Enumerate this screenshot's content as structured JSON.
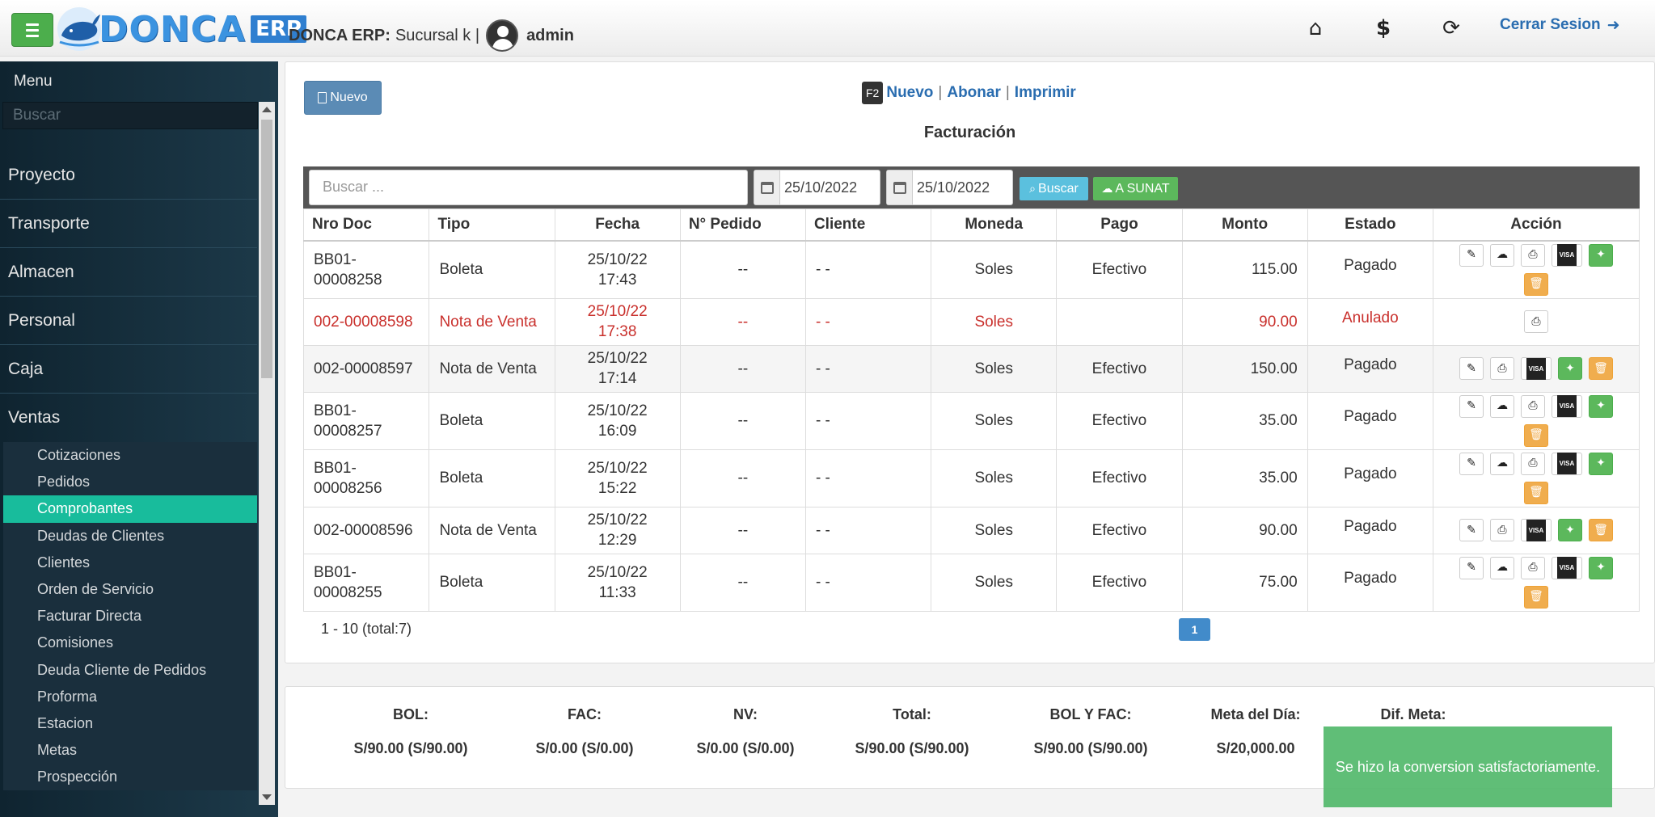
{
  "header": {
    "logo_name": "DONCA",
    "logo_suffix": "ERP",
    "brand_label": "DONCA ERP:",
    "branch": "Sucursal k |",
    "user": "admin",
    "icons": [
      "home-icon",
      "dollar-icon",
      "lock-refresh-icon"
    ],
    "logout_label": "Cerrar Sesion"
  },
  "sidebar": {
    "title": "Menu",
    "search_placeholder": "Buscar",
    "main_items": [
      "Proyecto",
      "Transporte",
      "Almacen",
      "Personal",
      "Caja",
      "Ventas"
    ],
    "sub_items": [
      "Cotizaciones",
      "Pedidos",
      "Comprobantes",
      "Deudas de Clientes",
      "Clientes",
      "Orden de Servicio",
      "Facturar Directa",
      "Comisiones",
      "Deuda Cliente de Pedidos",
      "Proforma",
      "Estacion",
      "Metas",
      "Prospección"
    ],
    "active_sub": "Comprobantes"
  },
  "toolbar": {
    "nuevo_label": "Nuevo",
    "shortcut_key": "F2",
    "link_nuevo": "Nuevo",
    "link_abonar": "Abonar",
    "link_imprimir": "Imprimir",
    "title": "Facturación"
  },
  "filters": {
    "search_placeholder": "Buscar ...",
    "date_from": "25/10/2022",
    "date_to": "25/10/2022",
    "buscar_label": "Buscar",
    "sunat_label": "A SUNAT"
  },
  "table": {
    "columns": [
      "Nro Doc",
      "Tipo",
      "Fecha",
      "N° Pedido",
      "Cliente",
      "Moneda",
      "Pago",
      "Monto",
      "Estado",
      "Acción"
    ],
    "rows": [
      {
        "nro": "BB01-\n00008258",
        "tipo": "Boleta",
        "fecha": "25/10/22\n17:43",
        "pedido": "--",
        "cliente": "- -",
        "moneda": "Soles",
        "pago": "Efectivo",
        "monto": "115.00",
        "estado": "Pagado",
        "style": "",
        "actions": [
          "edit",
          "cloud",
          "print",
          "visa",
          "wand",
          "trash"
        ]
      },
      {
        "nro": "002-00008598",
        "tipo": "Nota de Venta",
        "fecha": "25/10/22\n17:38",
        "pedido": "--",
        "cliente": "- -",
        "moneda": "Soles",
        "pago": "",
        "monto": "90.00",
        "estado": "Anulado",
        "style": "anul",
        "actions": [
          "print"
        ]
      },
      {
        "nro": "002-00008597",
        "tipo": "Nota de Venta",
        "fecha": "25/10/22\n17:14",
        "pedido": "--",
        "cliente": "- -",
        "moneda": "Soles",
        "pago": "Efectivo",
        "monto": "150.00",
        "estado": "Pagado",
        "style": "alt",
        "actions": [
          "edit",
          "print",
          "visa",
          "wand",
          "trash"
        ]
      },
      {
        "nro": "BB01-\n00008257",
        "tipo": "Boleta",
        "fecha": "25/10/22\n16:09",
        "pedido": "--",
        "cliente": "- -",
        "moneda": "Soles",
        "pago": "Efectivo",
        "monto": "35.00",
        "estado": "Pagado",
        "style": "",
        "actions": [
          "edit",
          "cloud",
          "print",
          "visa",
          "wand",
          "trash"
        ]
      },
      {
        "nro": "BB01-\n00008256",
        "tipo": "Boleta",
        "fecha": "25/10/22\n15:22",
        "pedido": "--",
        "cliente": "- -",
        "moneda": "Soles",
        "pago": "Efectivo",
        "monto": "35.00",
        "estado": "Pagado",
        "style": "",
        "actions": [
          "edit",
          "cloud",
          "print",
          "visa",
          "wand",
          "trash"
        ]
      },
      {
        "nro": "002-00008596",
        "tipo": "Nota de Venta",
        "fecha": "25/10/22\n12:29",
        "pedido": "--",
        "cliente": "- -",
        "moneda": "Soles",
        "pago": "Efectivo",
        "monto": "90.00",
        "estado": "Pagado",
        "style": "",
        "actions": [
          "edit",
          "print",
          "visa",
          "wand",
          "trash"
        ]
      },
      {
        "nro": "BB01-\n00008255",
        "tipo": "Boleta",
        "fecha": "25/10/22\n11:33",
        "pedido": "--",
        "cliente": "- -",
        "moneda": "Soles",
        "pago": "Efectivo",
        "monto": "75.00",
        "estado": "Pagado",
        "style": "",
        "actions": [
          "edit",
          "cloud",
          "print",
          "visa",
          "wand",
          "trash"
        ]
      }
    ]
  },
  "pager": {
    "summary": "1 - 10 (total:7)",
    "current_page": "1"
  },
  "summary": [
    {
      "label": "BOL:",
      "value": "S/90.00 (S/90.00)"
    },
    {
      "label": "FAC:",
      "value": "S/0.00 (S/0.00)"
    },
    {
      "label": "NV:",
      "value": "S/0.00 (S/0.00)"
    },
    {
      "label": "Total:",
      "value": "S/90.00 (S/90.00)"
    },
    {
      "label": "BOL Y FAC:",
      "value": "S/90.00 (S/90.00)"
    },
    {
      "label": "Meta del Día:",
      "value": "S/20,000.00"
    },
    {
      "label": "Dif. Meta:",
      "value": ""
    }
  ],
  "toast": {
    "message": "Se hizo la conversion satisfactoriamente."
  },
  "colors": {
    "accent_green": "#5cb85c",
    "active_teal": "#18bc9c",
    "annulled_red": "#c9302c",
    "link_blue": "#2a6db0"
  }
}
